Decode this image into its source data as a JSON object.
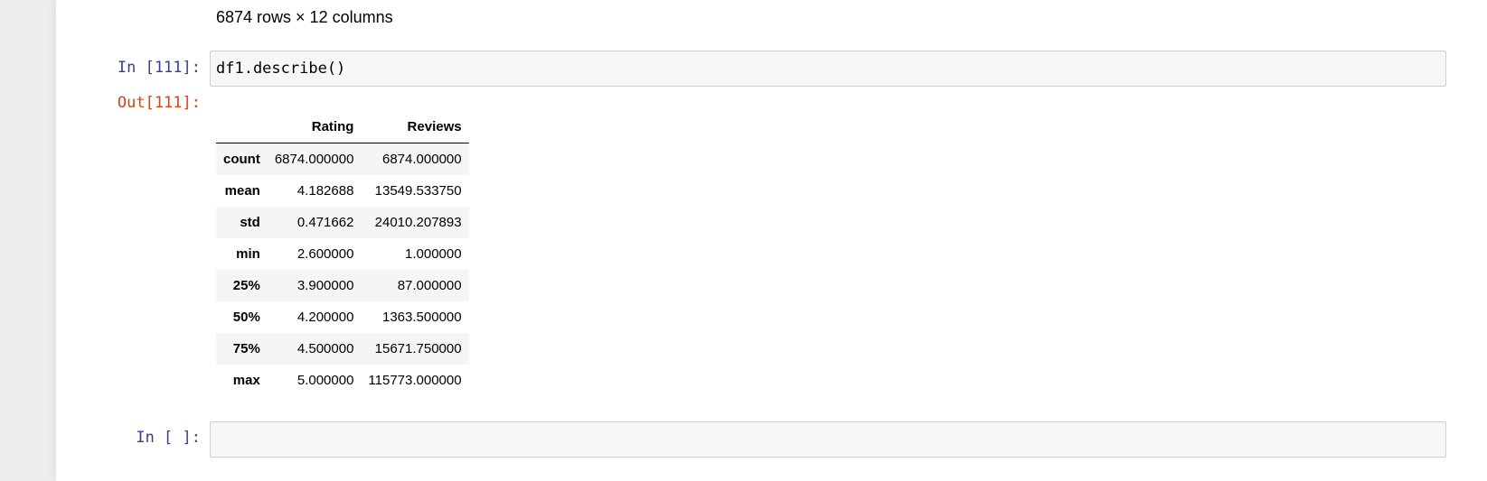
{
  "previous_output": {
    "rows_info": "6874 rows × 12 columns"
  },
  "cell_111": {
    "in_prompt": "In [111]:",
    "code": "df1.describe()",
    "out_prompt": "Out[111]:"
  },
  "dataframe": {
    "columns": [
      "",
      "Rating",
      "Reviews"
    ],
    "rows": [
      {
        "index": "count",
        "rating": "6874.000000",
        "reviews": "6874.000000"
      },
      {
        "index": "mean",
        "rating": "4.182688",
        "reviews": "13549.533750"
      },
      {
        "index": "std",
        "rating": "0.471662",
        "reviews": "24010.207893"
      },
      {
        "index": "min",
        "rating": "2.600000",
        "reviews": "1.000000"
      },
      {
        "index": "25%",
        "rating": "3.900000",
        "reviews": "87.000000"
      },
      {
        "index": "50%",
        "rating": "4.200000",
        "reviews": "1363.500000"
      },
      {
        "index": "75%",
        "rating": "4.500000",
        "reviews": "15671.750000"
      },
      {
        "index": "max",
        "rating": "5.000000",
        "reviews": "115773.000000"
      }
    ]
  },
  "empty_cell": {
    "in_prompt": "In [ ]:",
    "code": ""
  },
  "colors": {
    "in_prompt": "#303F9F",
    "out_prompt": "#D84315",
    "input_background": "#f7f7f7"
  }
}
